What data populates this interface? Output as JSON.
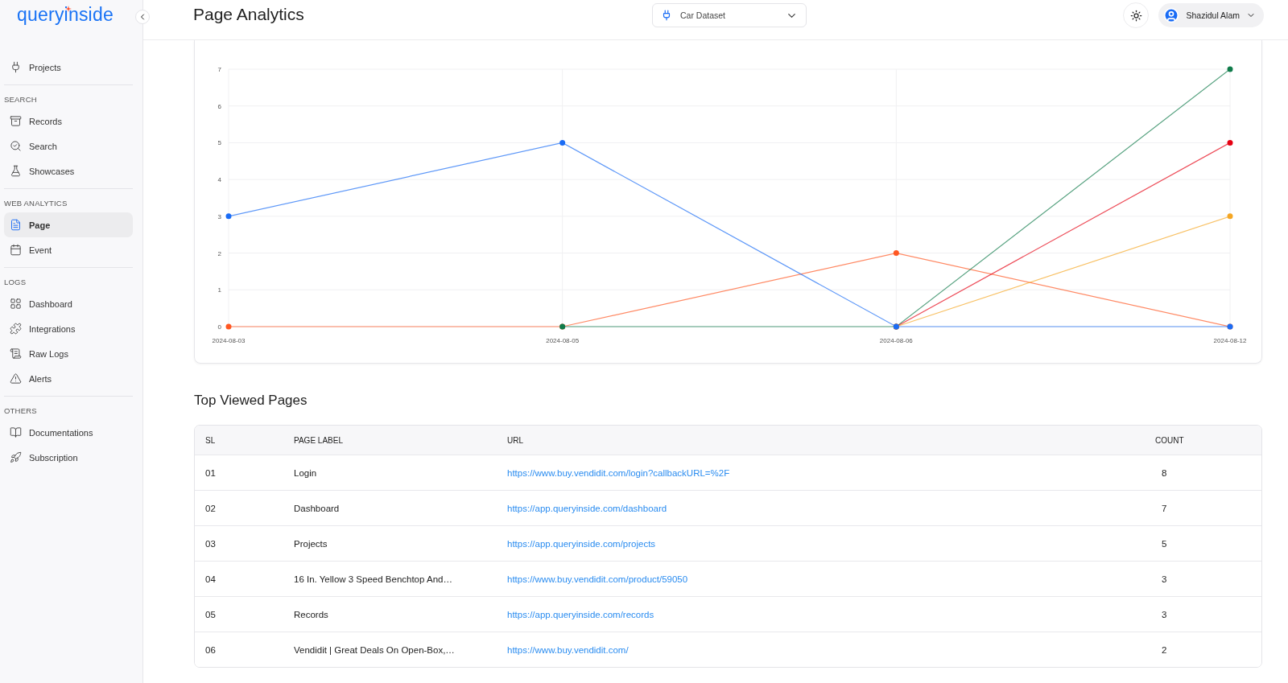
{
  "sidebar": {
    "logo": "queryinside",
    "top_items": [
      {
        "label": "Projects",
        "selected": false
      }
    ],
    "sections": [
      {
        "title": "SEARCH",
        "items": [
          {
            "label": "Records",
            "selected": false
          },
          {
            "label": "Search",
            "selected": false
          },
          {
            "label": "Showcases",
            "selected": false
          }
        ]
      },
      {
        "title": "WEB ANALYTICS",
        "items": [
          {
            "label": "Page",
            "selected": true
          },
          {
            "label": "Event",
            "selected": false
          }
        ]
      },
      {
        "title": "LOGS",
        "items": [
          {
            "label": "Dashboard",
            "selected": false
          },
          {
            "label": "Integrations",
            "selected": false
          },
          {
            "label": "Raw Logs",
            "selected": false
          },
          {
            "label": "Alerts",
            "selected": false
          }
        ]
      },
      {
        "title": "OTHERS",
        "items": [
          {
            "label": "Documentations",
            "selected": false
          },
          {
            "label": "Subscription",
            "selected": false
          }
        ]
      }
    ]
  },
  "header": {
    "title": "Page Analytics",
    "dataset": "Car Dataset",
    "user": "Shazidul Alam"
  },
  "chart": {
    "chart_data": {
      "type": "line",
      "categories": [
        "2024-08-03",
        "2024-08-05",
        "2024-08-06",
        "2024-08-12"
      ],
      "ylim": [
        0,
        7
      ],
      "grid": true,
      "yticks": [
        0,
        1,
        2,
        3,
        4,
        5,
        6,
        7
      ],
      "series": [
        {
          "color": "#ff5722",
          "marker": true,
          "values": [
            0,
            0,
            2,
            0
          ]
        },
        {
          "color": "#0f7b4a",
          "marker": true,
          "values": [
            null,
            0,
            0,
            7
          ]
        },
        {
          "color": "#e60012",
          "marker": true,
          "values": [
            null,
            null,
            0,
            5
          ]
        },
        {
          "color": "#f5a623",
          "marker": true,
          "values": [
            null,
            null,
            0,
            3
          ]
        },
        {
          "color": "#1a6cf5",
          "marker": true,
          "values": [
            3,
            5,
            0,
            0
          ]
        }
      ]
    }
  },
  "table": {
    "title": "Top Viewed Pages",
    "columns": [
      "SL",
      "PAGE LABEL",
      "URL",
      "COUNT"
    ],
    "rows": [
      [
        "01",
        "Login",
        "https://www.buy.vendidit.com/login?callbackURL=%2F",
        "8"
      ],
      [
        "02",
        "Dashboard",
        "https://app.queryinside.com/dashboard",
        "7"
      ],
      [
        "03",
        "Projects",
        "https://app.queryinside.com/projects",
        "5"
      ],
      [
        "04",
        "16 In. Yellow 3 Speed Benchtop And…",
        "https://www.buy.vendidit.com/product/59050",
        "3"
      ],
      [
        "05",
        "Records",
        "https://app.queryinside.com/records",
        "3"
      ],
      [
        "06",
        "Vendidit | Great Deals On Open-Box,…",
        "https://www.buy.vendidit.com/",
        "2"
      ]
    ]
  }
}
